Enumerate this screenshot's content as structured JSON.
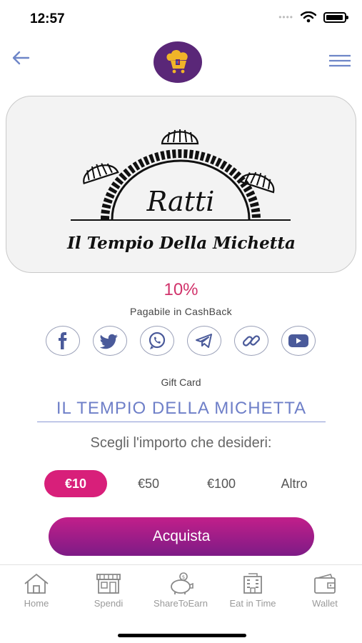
{
  "status": {
    "time": "12:57"
  },
  "header": {
    "logo_icon": "chef-hat-cart-logo",
    "back_icon": "arrow-left-icon",
    "menu_icon": "hamburger-menu-icon"
  },
  "shop": {
    "logo_script": "Ratti",
    "logo_subtitle": "Il Tempio Della Michetta",
    "cashback_percent": "10%",
    "cashback_label": "Pagabile in CashBack",
    "gift_card_label": "Gift Card",
    "name": "IL TEMPIO DELLA MICHETTA"
  },
  "socials": [
    "facebook",
    "twitter",
    "whatsapp",
    "telegram",
    "link",
    "youtube"
  ],
  "amounts": {
    "prompt": "Scegli l'importo che desideri:",
    "options": [
      "€10",
      "€50",
      "€100",
      "Altro"
    ],
    "selected": "€10"
  },
  "buy_label": "Acquista",
  "tabs": [
    "Home",
    "Spendi",
    "ShareToEarn",
    "Eat in Time",
    "Wallet"
  ],
  "colors": {
    "accent": "#d81f7a",
    "purple": "#7d1b86",
    "shop_name": "#6e7fc8",
    "cashback": "#d1336b"
  }
}
